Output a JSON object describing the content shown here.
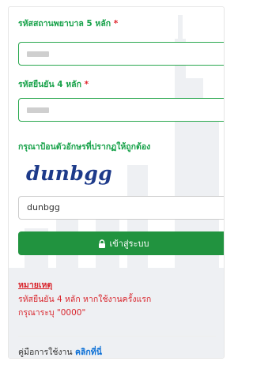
{
  "form": {
    "hospital_code_label": "รหัสสถานพยาบาล 5 หลัก",
    "required_mark": "*",
    "confirm_code_label": "รหัสยืนยัน 4 หลัก",
    "captcha_instruction": "กรุณาป้อนตัวอักษรที่ปรากฏให้ถูกต้อง",
    "captcha_text": "dunbgg",
    "captcha_input_value": "dunbgg",
    "login_label": "เข้าสู่ระบบ"
  },
  "note": {
    "title": "หมายเหตุ",
    "line1": "รหัสยืนยัน 4 หลัก หากใช้งานครั้งแรก",
    "line2": "กรุณาระบุ \"0000\""
  },
  "footer": {
    "manual_text": "คู่มือการใช้งาน",
    "manual_link": "คลิกที่นี่"
  },
  "colors": {
    "green_label": "#18a24a",
    "button": "#21933f",
    "red": "#d9262d",
    "link": "#0b6fd6"
  }
}
